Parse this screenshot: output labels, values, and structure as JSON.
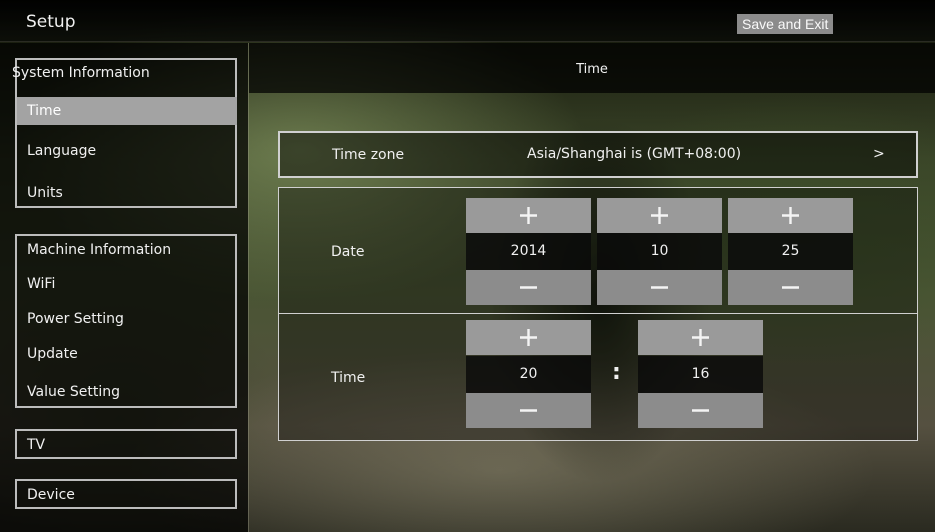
{
  "app": {
    "title": "Setup",
    "save_exit": "Save and Exit"
  },
  "sidebar": {
    "groups": [
      {
        "items": [
          "System Information",
          "Time",
          "Language",
          "Units"
        ]
      },
      {
        "items": [
          "Machine Information",
          "WiFi",
          "Power Setting",
          "Update",
          "Value Setting"
        ]
      },
      {
        "items": [
          "TV"
        ]
      },
      {
        "items": [
          "Device"
        ]
      }
    ],
    "selected": "Time"
  },
  "page": {
    "title": "Time"
  },
  "timezone": {
    "label": "Time zone",
    "value": "Asia/Shanghai is (GMT+08:00)",
    "arrow": ">"
  },
  "date": {
    "label": "Date",
    "year": "2014",
    "month": "10",
    "day": "25"
  },
  "time": {
    "label": "Time",
    "hour": "20",
    "minute": "16",
    "separator": ":"
  },
  "icons": {
    "increment": "plus-icon",
    "decrement": "minus-icon"
  },
  "colors": {
    "selected_bg": "#a3a3a3",
    "button_bg": "#9a9a9a",
    "value_bg": "#0a0a0a"
  }
}
